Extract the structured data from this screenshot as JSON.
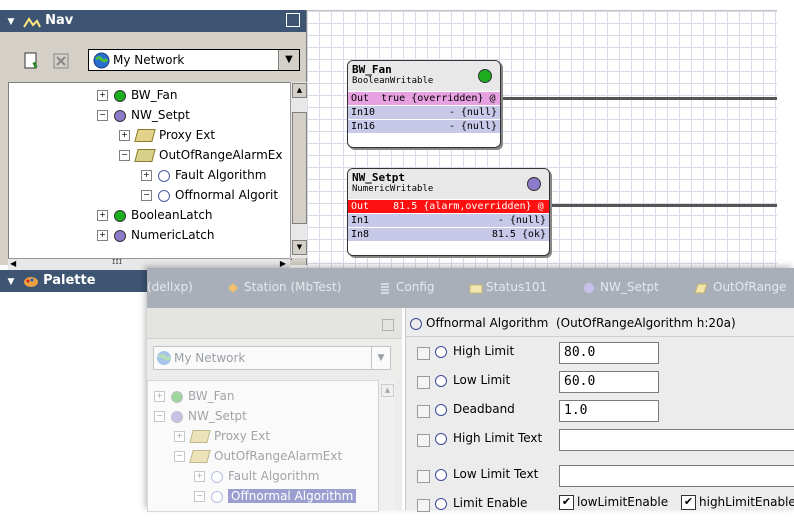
{
  "nav": {
    "title": "Nav",
    "network_select": "My Network",
    "tree": [
      {
        "label": "BW_Fan",
        "icon": "green-dot-icon",
        "toggle": "+"
      },
      {
        "label": "NW_Setpt",
        "icon": "purple-dot-icon",
        "toggle": "−"
      },
      {
        "label": "Proxy Ext",
        "icon": "folder-icon",
        "toggle": "+"
      },
      {
        "label": "OutOfRangeAlarmEx",
        "icon": "alarm-ext-icon",
        "toggle": "−"
      },
      {
        "label": "Fault Algorithm",
        "icon": "hollow-dot-icon",
        "toggle": "+"
      },
      {
        "label": "Offnormal Algorit",
        "icon": "hollow-dot-icon",
        "toggle": "−"
      },
      {
        "label": "BooleanLatch",
        "icon": "green-dot-icon",
        "toggle": "+"
      },
      {
        "label": "NumericLatch",
        "icon": "purple-dot-icon",
        "toggle": "+"
      }
    ],
    "hscroll_label": "ɪɪɪ"
  },
  "palette": {
    "title": "Palette"
  },
  "wiresheet": {
    "blocks": [
      {
        "name": "BW_Fan",
        "type": "BooleanWritable",
        "status_color": "#1fae1f",
        "slots": [
          {
            "name": "Out",
            "value": "true {overridden} @ 8",
            "style": "pink"
          },
          {
            "name": "In10",
            "value": "- {null}",
            "style": "lav"
          },
          {
            "name": "In16",
            "value": "- {null}",
            "style": "lav"
          }
        ]
      },
      {
        "name": "NW_Setpt",
        "type": "NumericWritable",
        "status_color": "#8b7bc9",
        "slots": [
          {
            "name": "Out",
            "value": "81.5 {alarm,overridden} @ 8",
            "style": "red"
          },
          {
            "name": "In1",
            "value": "- {null}",
            "style": "lav"
          },
          {
            "name": "In8",
            "value": "81.5 {ok}",
            "style": "lav"
          }
        ]
      }
    ]
  },
  "front": {
    "tabs": [
      {
        "label": "(dellxp)",
        "icon": ""
      },
      {
        "label": "Station (MbTest)",
        "icon": "station-icon"
      },
      {
        "label": "Config",
        "icon": "config-icon"
      },
      {
        "label": "Status101",
        "icon": "folder-icon"
      },
      {
        "label": "NW_Setpt",
        "icon": "purple-dot-icon"
      },
      {
        "label": "OutOfRange",
        "icon": "alarm-ext-icon"
      }
    ],
    "network_select": "My Network",
    "tree": [
      {
        "label": "BW_Fan",
        "icon": "green-dot-icon",
        "toggle": "+"
      },
      {
        "label": "NW_Setpt",
        "icon": "purple-dot-icon",
        "toggle": "−"
      },
      {
        "label": "Proxy Ext",
        "icon": "folder-icon",
        "toggle": "+"
      },
      {
        "label": "OutOfRangeAlarmExt",
        "icon": "alarm-ext-icon",
        "toggle": "−"
      },
      {
        "label": "Fault Algorithm",
        "icon": "hollow-dot-icon",
        "toggle": "+"
      },
      {
        "label": "Offnormal Algorithm",
        "icon": "hollow-dot-icon",
        "toggle": "−",
        "selected": true
      }
    ],
    "property_sheet": {
      "title_name": "Offnormal Algorithm",
      "title_type": "(OutOfRangeAlgorithm h:20a)",
      "rows": [
        {
          "label": "High Limit",
          "value": "80.0"
        },
        {
          "label": "Low Limit",
          "value": "60.0"
        },
        {
          "label": "Deadband",
          "value": "1.0"
        },
        {
          "label": "High Limit Text",
          "value": ""
        },
        {
          "label": "Low Limit Text",
          "value": ""
        },
        {
          "label": "Limit Enable",
          "options": [
            "lowLimitEnable",
            "highLimitEnable"
          ]
        }
      ]
    }
  }
}
